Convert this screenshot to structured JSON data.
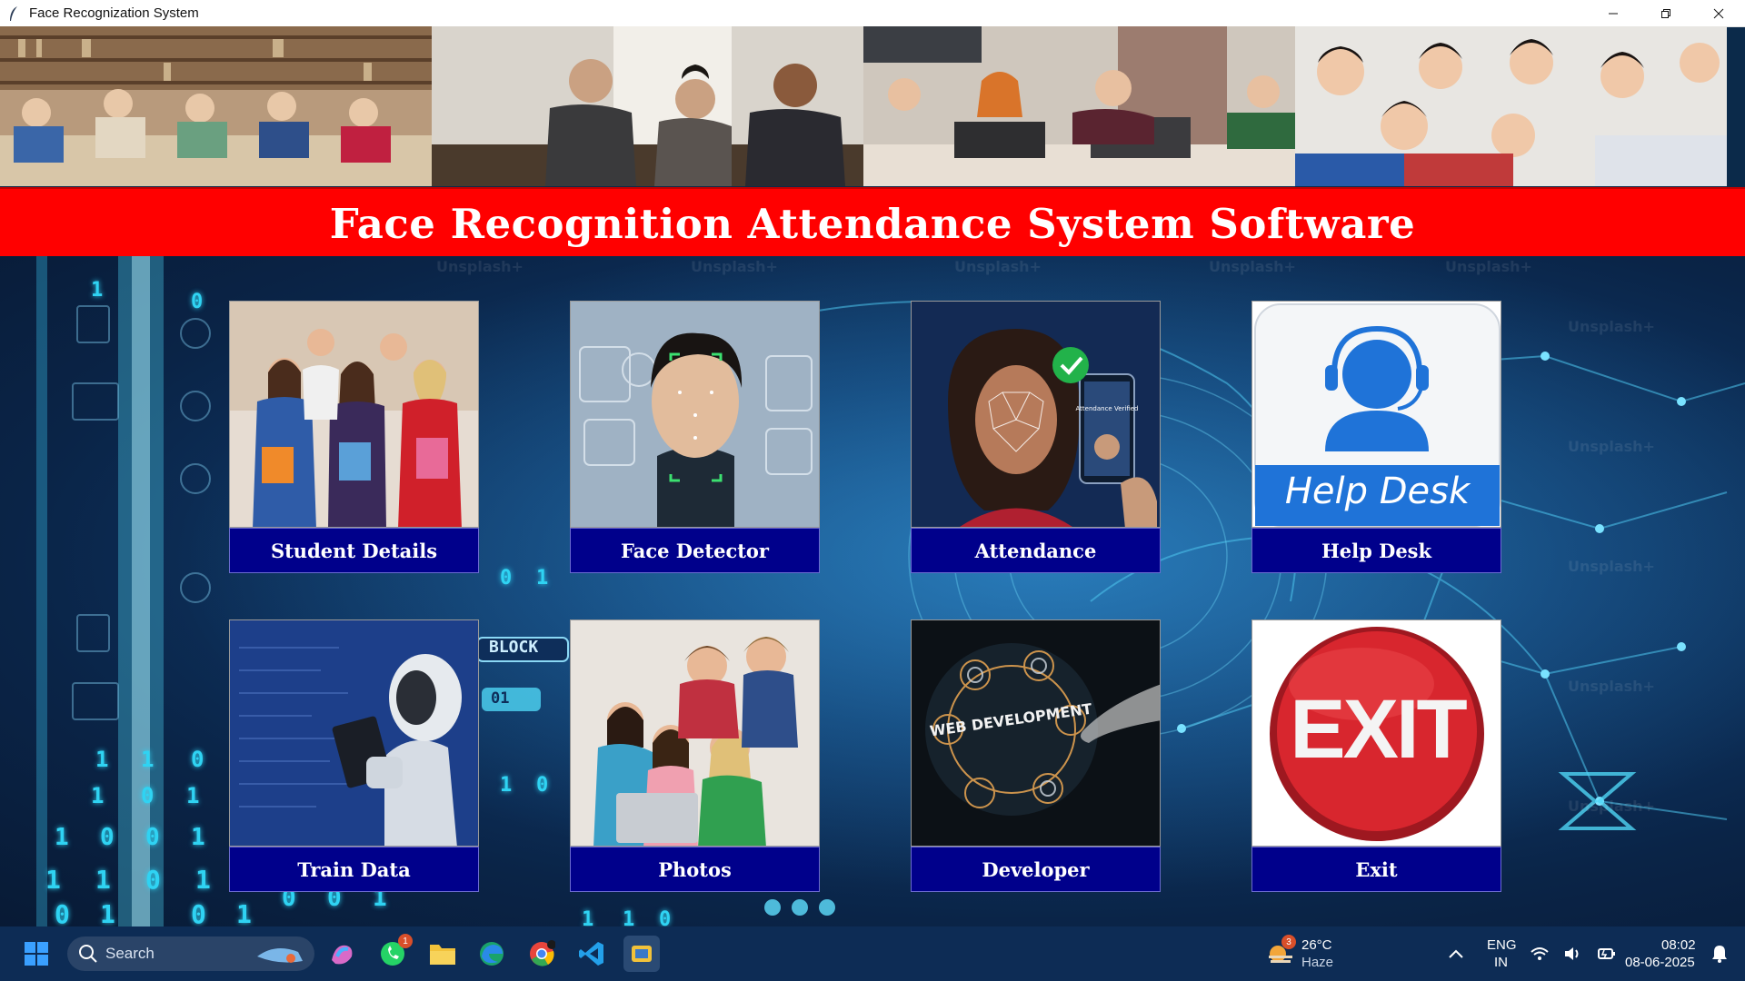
{
  "window": {
    "title": "Face Recognization System",
    "controls": [
      "minimize-icon",
      "restore-icon",
      "close-icon"
    ]
  },
  "banner": {
    "images": [
      "students-studying-library",
      "students-classroom",
      "students-laptops",
      "students-group-laptop"
    ]
  },
  "header": {
    "title": "Face Recognition Attendance System Software",
    "background_color": "#ff0000",
    "text_color": "#ffffff"
  },
  "background": {
    "watermark": "Unsplash+",
    "binary_digits": [
      "1",
      "0",
      "1",
      "1",
      "0",
      "1",
      "0",
      "1",
      "1",
      "0",
      "0",
      "1",
      "1",
      "1",
      "0",
      "1",
      "0",
      "1",
      "0",
      "1",
      "0",
      "0",
      "1",
      "0",
      "1",
      "1",
      "0",
      "1",
      "1",
      "0"
    ],
    "block_label": "BLOCK",
    "block_label_2": "01"
  },
  "tiles": [
    {
      "label": "Student Details",
      "image": "students-with-books"
    },
    {
      "label": "Face Detector",
      "image": "face-scan"
    },
    {
      "label": "Attendance",
      "image": "face-verified-phone",
      "image_text": "Attendance Verified"
    },
    {
      "label": "Help Desk",
      "image": "help-desk-headset",
      "image_text": "Help Desk"
    },
    {
      "label": "Train Data",
      "image": "robot-with-tablet"
    },
    {
      "label": "Photos",
      "image": "students-looking-at-laptop"
    },
    {
      "label": "Developer",
      "image": "web-development",
      "image_text": "WEB DEVELOPMENT"
    },
    {
      "label": "Exit",
      "image": "exit-button",
      "image_text": "EXIT"
    }
  ],
  "tile_label_bg": "#00008b",
  "taskbar": {
    "search_placeholder": "Search",
    "weather": {
      "temp": "26°C",
      "condition": "Haze",
      "badge": "3"
    },
    "whatsapp_badge": "1",
    "language": {
      "lang": "ENG",
      "region": "IN"
    },
    "clock": {
      "time": "08:02",
      "date": "08-06-2025"
    }
  }
}
